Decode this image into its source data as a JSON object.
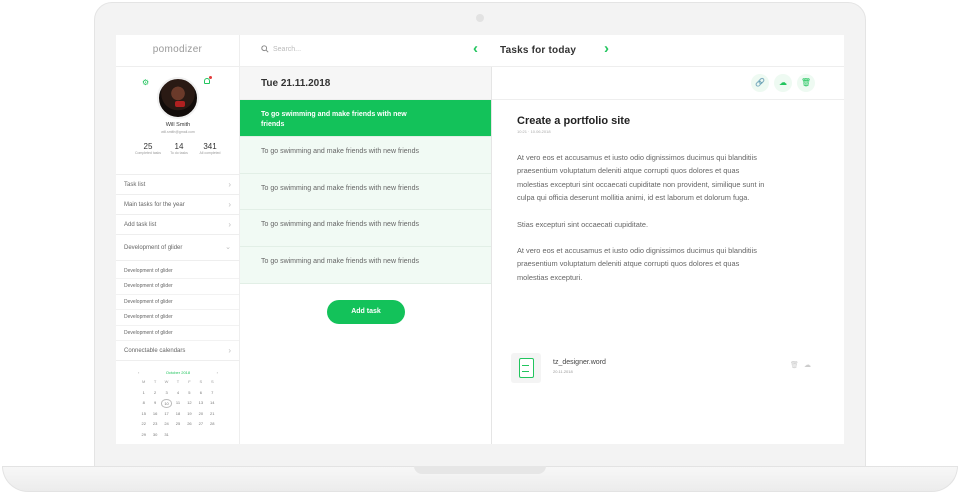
{
  "app": {
    "logo": "pomodizer"
  },
  "search": {
    "placeholder": "Search..."
  },
  "header": {
    "title": "Tasks for today",
    "prev": "‹",
    "next": "›"
  },
  "profile": {
    "name": "Will Smith",
    "email": "will.smith@gmail.com",
    "stats": [
      {
        "value": "25",
        "label": "Completed tasks"
      },
      {
        "value": "14",
        "label": "To do tasks"
      },
      {
        "value": "341",
        "label": "All completed"
      }
    ]
  },
  "menu": {
    "task_list": "Task list",
    "main_tasks": "Main tasks for the year",
    "add_task_list": "Add task list",
    "glider": "Development of glider",
    "glider_items": [
      "Development of glider",
      "Development of glider",
      "Development of glider",
      "Development of glider",
      "Development of glider"
    ],
    "calendars": "Connectable calendars"
  },
  "calendar": {
    "month": "October 2018",
    "weekdays": [
      "M",
      "T",
      "W",
      "T",
      "F",
      "S",
      "S"
    ],
    "days": [
      "1",
      "2",
      "3",
      "4",
      "5",
      "6",
      "7",
      "8",
      "9",
      "10",
      "11",
      "12",
      "13",
      "14",
      "15",
      "16",
      "17",
      "18",
      "19",
      "20",
      "21",
      "22",
      "23",
      "24",
      "25",
      "26",
      "27",
      "28",
      "29",
      "30",
      "31"
    ],
    "today": "10"
  },
  "tasks": {
    "date": "Tue 21.11.2018",
    "items": [
      "To go swimming and make friends with new friends",
      "To go swimming and make friends with new friends",
      "To go swimming and make friends with new friends",
      "To go swimming and make friends with new friends",
      "To go swimming and make friends with new friends"
    ],
    "add_label": "Add task"
  },
  "detail": {
    "title": "Create a portfolio site",
    "date": "10:21 · 10.06.2018",
    "paragraphs": [
      "At vero eos et accusamus et iusto odio dignissimos ducimus qui blanditiis praesentium voluptatum deleniti atque corrupti quos dolores et quas molestias excepturi sint occaecati cupiditate non provident, similique sunt in culpa qui officia deserunt mollitia animi, id est laborum et dolorum fuga.",
      "Stias excepturi sint occaecati cupiditate.",
      "At vero eos et accusamus et iusto odio dignissimos ducimus qui blanditiis praesentium voluptatum deleniti atque corrupti quos dolores et quas molestias excepturi."
    ],
    "file": {
      "name": "tz_designer.word",
      "date": "20.11.2018"
    }
  },
  "colors": {
    "accent": "#13c25a"
  }
}
